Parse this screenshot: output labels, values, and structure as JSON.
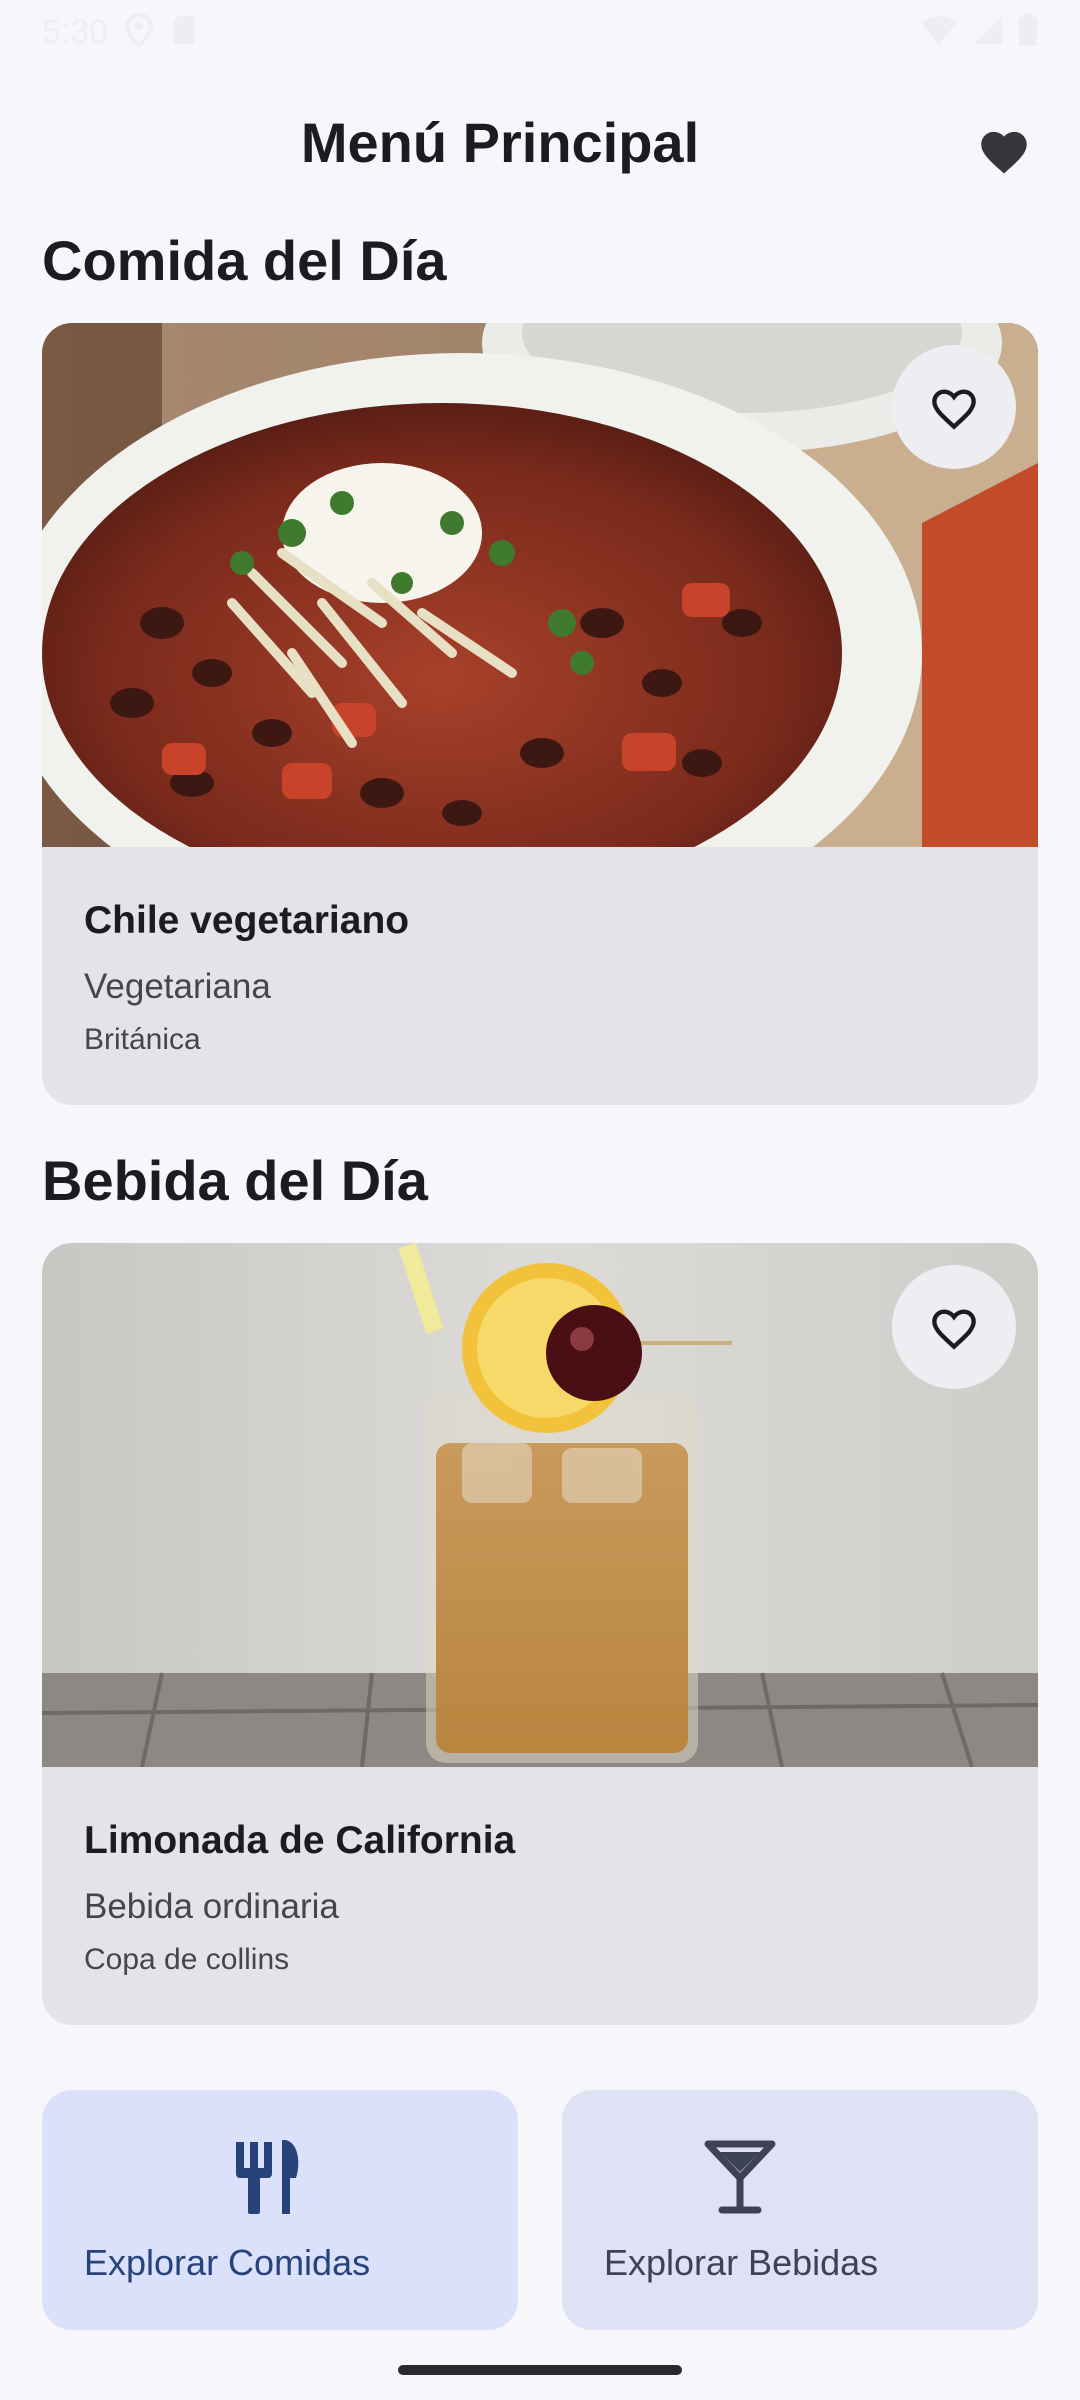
{
  "status_bar": {
    "time": "5:30"
  },
  "app_bar": {
    "title": "Menú Principal",
    "favorites_icon": "heart-filled-icon"
  },
  "meal_section": {
    "title": "Comida del Día",
    "card": {
      "name": "Chile vegetariano",
      "category": "Vegetariana",
      "area": "Británica",
      "image": "vegetarian-chili-bowl-photo",
      "favorite_icon": "heart-outline-icon"
    }
  },
  "drink_section": {
    "title": "Bebida del Día",
    "card": {
      "name": "Limonada de California",
      "category": "Bebida ordinaria",
      "glass": "Copa de collins",
      "image": "california-lemonade-glass-photo",
      "favorite_icon": "heart-outline-icon"
    }
  },
  "explore": {
    "meals_label": "Explorar Comidas",
    "meals_icon": "fork-knife-icon",
    "drinks_label": "Explorar Bebidas",
    "drinks_icon": "cocktail-glass-icon"
  },
  "colors": {
    "background": "#f7f6fb",
    "card_background": "#e4e3e8",
    "explore_meals_bg": "#dbe1fb",
    "explore_drinks_bg": "#dfe2f4",
    "explore_meals_text": "#28427a",
    "explore_drinks_text": "#3d4257"
  }
}
